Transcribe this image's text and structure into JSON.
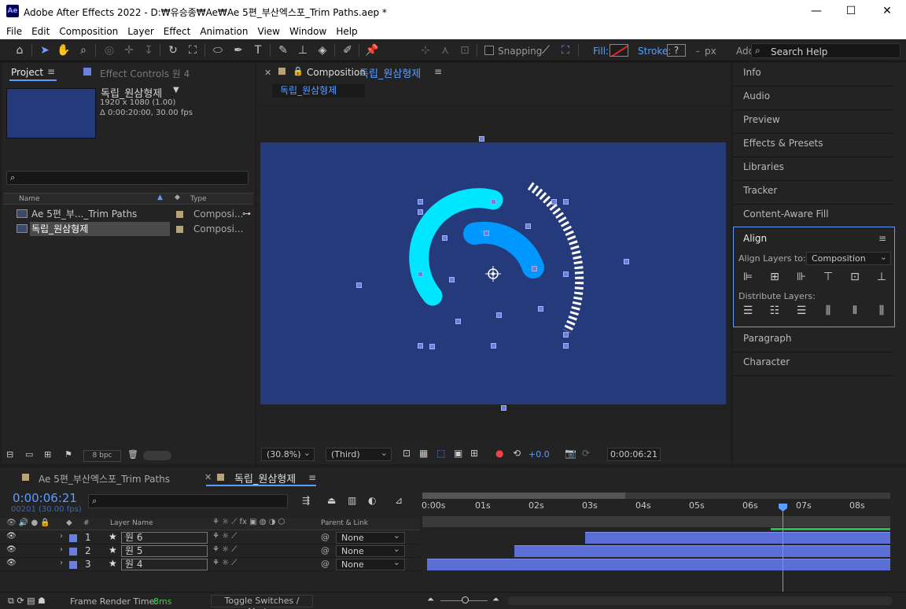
{
  "window": {
    "title": "Adobe After Effects 2022 - D:₩유승종₩Ae₩Ae 5편_부산엑스포_Trim Paths.aep *",
    "logo": "Ae",
    "minimize": "—",
    "maximize": "☐",
    "close": "✕"
  },
  "menu": [
    "File",
    "Edit",
    "Composition",
    "Layer",
    "Effect",
    "Animation",
    "View",
    "Window",
    "Help"
  ],
  "toolbar": {
    "snapping": "Snapping",
    "fill": "Fill:",
    "stroke": "Stroke:",
    "stroke_value": "?",
    "stroke_dash": "-",
    "px": "px",
    "add": "Add:",
    "search_help": "Search Help"
  },
  "project": {
    "tab": "Project",
    "effect_controls_tab": "Effect Controls 원 4",
    "comp_name": "독립_원삼형제",
    "comp_res": "1920 x 1080 (1.00)",
    "comp_dur": "Δ 0:00:20:00, 30.00 fps",
    "col_name": "Name",
    "col_type": "Type",
    "rows": [
      {
        "name": "Ae 5편_부..._Trim Paths",
        "type": "Composi..."
      },
      {
        "name": "독립_원삼형제",
        "type": "Composi..."
      }
    ],
    "bpc": "8 bpc"
  },
  "viewer": {
    "tab_label": "Composition",
    "tab_comp": "독립_원삼형제",
    "comp_chip": "독립_원삼형제",
    "zoom": "(30.8%)",
    "resolution": "(Third)",
    "exposure": "+0.0",
    "timecode": "0:00:06:21"
  },
  "right_panels": {
    "items_top": [
      "Info",
      "Audio",
      "Preview",
      "Effects & Presets",
      "Libraries",
      "Tracker",
      "Content-Aware Fill"
    ],
    "align_title": "Align",
    "align_layers_to": "Align Layers to:",
    "align_target": "Composition",
    "distribute_layers": "Distribute Layers:",
    "items_bottom": [
      "Paragraph",
      "Character"
    ]
  },
  "timeline": {
    "tab_other": "Ae 5편_부산엑스포_Trim Paths",
    "tab_active": "독립_원삼형제",
    "timecode": "0:00:06:21",
    "fps_info": "00201 (30.00 fps)",
    "col_layer_name": "Layer Name",
    "col_hash": "#",
    "col_parent": "Parent & Link",
    "ruler": [
      "0:00s",
      "01s",
      "02s",
      "03s",
      "04s",
      "05s",
      "06s",
      "07s",
      "08s"
    ],
    "layers": [
      {
        "num": "1",
        "name": "원 6",
        "parent": "None",
        "start": 0.3375
      },
      {
        "num": "2",
        "name": "원 5",
        "parent": "None",
        "start": 0.186
      },
      {
        "num": "3",
        "name": "원 4",
        "parent": "None",
        "start": 0.0
      }
    ],
    "render_label": "Frame Render Time:",
    "render_value": "8ms",
    "toggle": "Toggle Switches / Modes"
  },
  "colors": {
    "accent": "#5b9eff",
    "comp_bg": "#253a7a",
    "arc_cyan": "#00e6ff",
    "arc_blue": "#0098ff",
    "layer_bar": "#5a6ed6"
  }
}
